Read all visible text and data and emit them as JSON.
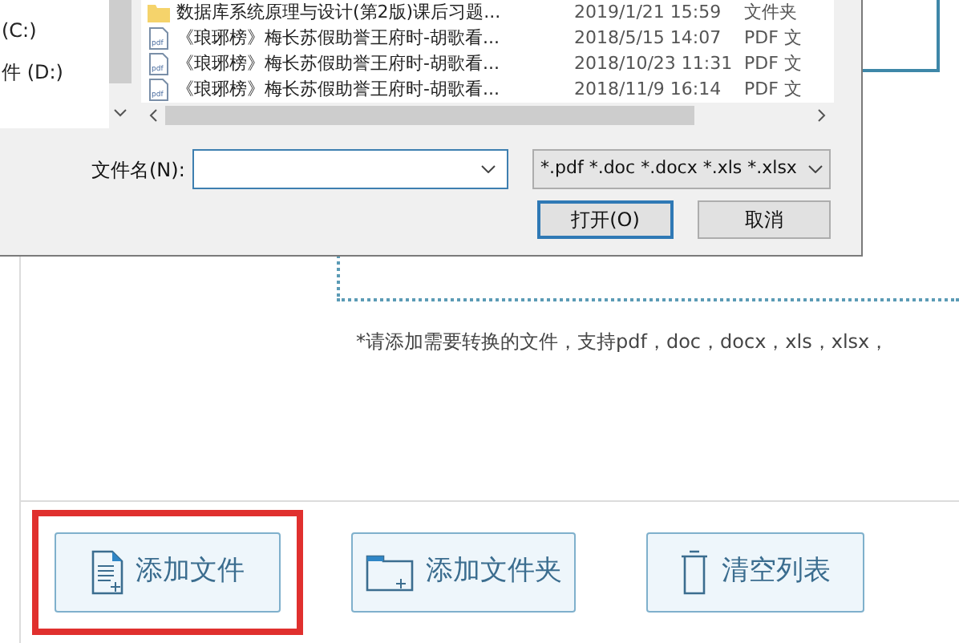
{
  "dialog": {
    "nav_items": [
      "(C:)",
      "件 (D:)"
    ],
    "files": [
      {
        "kind": "folder",
        "name": "数据库系统原理与设计(第2版)课后习题...",
        "date": "2019/1/21 15:59",
        "type": "文件夹"
      },
      {
        "kind": "pdf",
        "name": "《琅琊榜》梅长苏假助誉王府时-胡歌看...",
        "date": "2018/5/15 14:07",
        "type": "PDF 文"
      },
      {
        "kind": "pdf",
        "name": "《琅琊榜》梅长苏假助誉王府时-胡歌看...",
        "date": "2018/10/23 11:31",
        "type": "PDF 文"
      },
      {
        "kind": "pdf",
        "name": "《琅琊榜》梅长苏假助誉王府时-胡歌看...",
        "date": "2018/11/9 16:14",
        "type": "PDF 文"
      }
    ],
    "filename_label": "文件名(N):",
    "filter": "*.pdf *.doc *.docx *.xls *.xlsx",
    "open_button": "打开(O)",
    "cancel_button": "取消"
  },
  "hint": "*请添加需要转换的文件，支持pdf，doc，docx，xls，xlsx，",
  "actions": [
    {
      "kind": "file",
      "label": "添加文件",
      "highlighted": true
    },
    {
      "kind": "folder",
      "label": "添加文件夹",
      "highlighted": false
    },
    {
      "kind": "trash",
      "label": "清空列表",
      "highlighted": false
    }
  ]
}
